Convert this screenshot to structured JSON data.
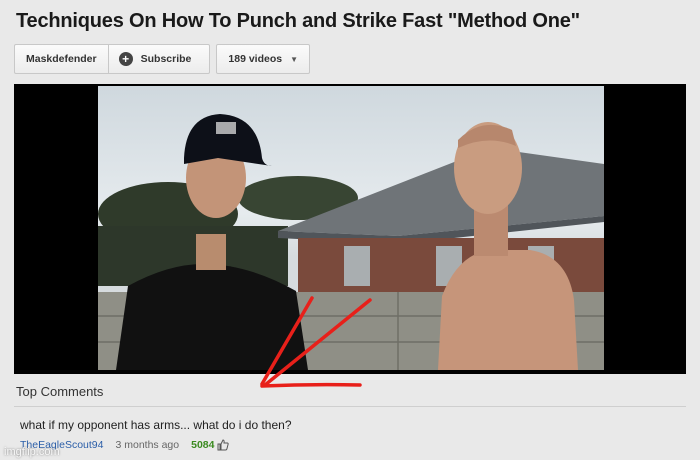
{
  "video": {
    "title": "Techniques On How To Punch and Strike Fast \"Method One\""
  },
  "channel": {
    "owner_label": "Maskdefender",
    "subscribe_label": "Subscribe",
    "videos_label": "189 videos"
  },
  "comments": {
    "heading": "Top Comments",
    "items": [
      {
        "text": "what if my opponent has arms... what do i do then?",
        "user": "TheEagleScout94",
        "time": "3 months ago",
        "likes": "5084"
      }
    ]
  },
  "watermark": "imgflip.com",
  "colors": {
    "annotation_arrow": "#e8201a",
    "username_link": "#2b5ea8",
    "likes_green": "#3a8a1f"
  }
}
